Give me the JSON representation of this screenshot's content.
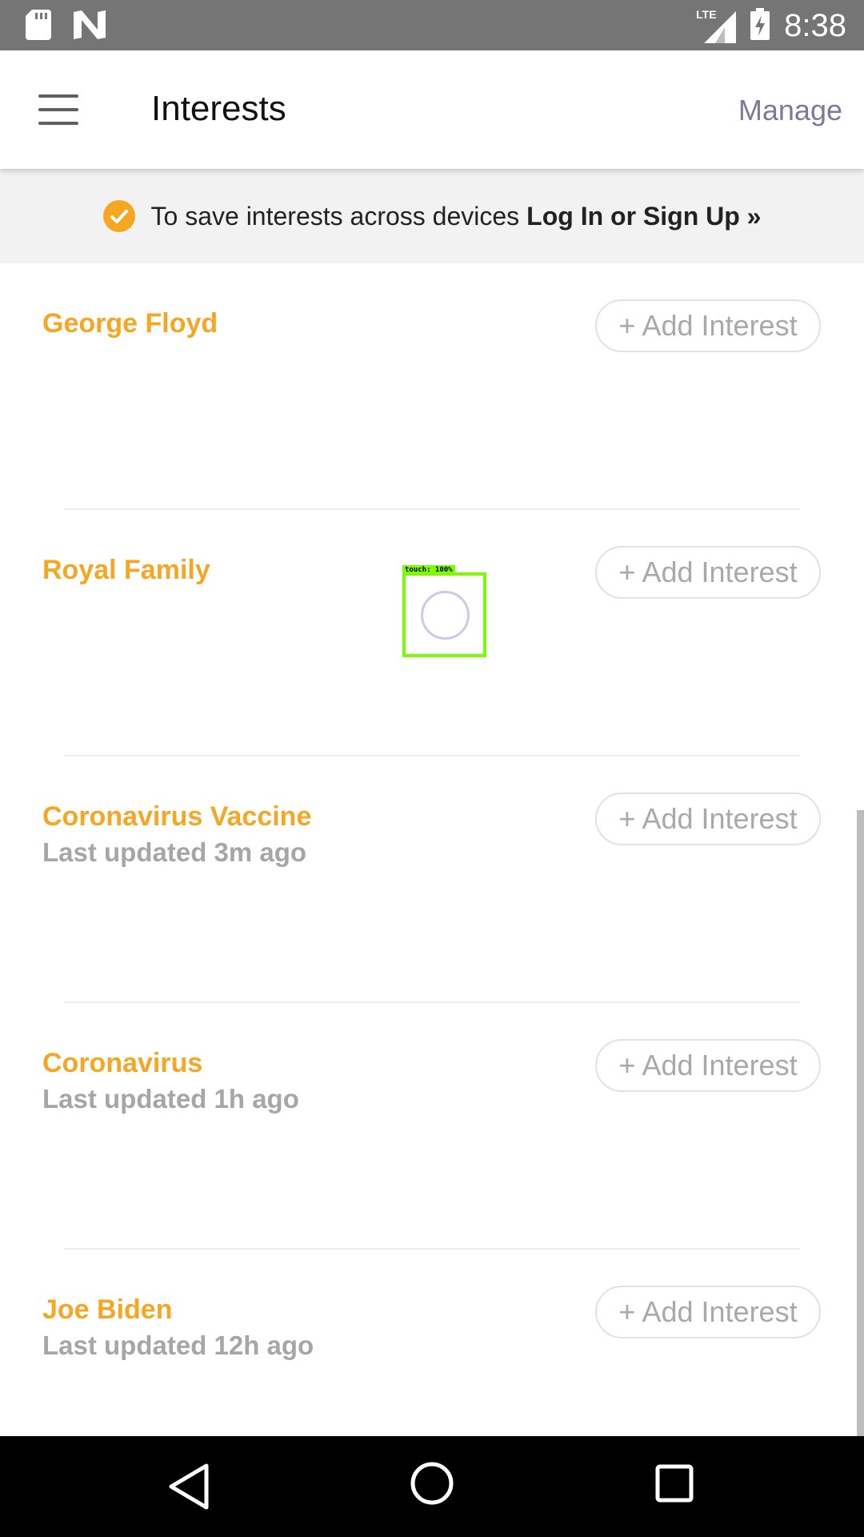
{
  "status_bar": {
    "time": "8:38",
    "network_label": "LTE",
    "icons": [
      "sd-card-icon",
      "n-notification-icon",
      "lte-signal-icon",
      "battery-charging-icon"
    ]
  },
  "app_bar": {
    "title": "Interests",
    "manage_label": "Manage",
    "menu_icon": "hamburger-menu-icon"
  },
  "banner": {
    "text": "To save interests across devices",
    "link": "Log In or Sign Up »",
    "icon": "check-circle-icon",
    "icon_color": "#f5a623"
  },
  "interests": [
    {
      "name": "George Floyd",
      "updated": "",
      "button": "+ Add Interest"
    },
    {
      "name": "Royal Family",
      "updated": "",
      "button": "+ Add Interest"
    },
    {
      "name": "Coronavirus Vaccine",
      "updated": "Last updated 3m ago",
      "button": "+ Add Interest"
    },
    {
      "name": "Coronavirus",
      "updated": "Last updated 1h ago",
      "button": "+ Add Interest"
    },
    {
      "name": "Joe Biden",
      "updated": "Last updated 12h ago",
      "button": "+ Add Interest"
    }
  ],
  "touch_indicator": {
    "label": "touch: 100%"
  },
  "colors": {
    "accent": "#f5a623",
    "muted_text": "#a6a6a6",
    "status_bar": "#757575",
    "banner_bg": "#f2f2f2"
  },
  "nav_bar": {
    "icons": [
      "back-triangle-icon",
      "home-circle-icon",
      "recents-square-icon"
    ]
  }
}
